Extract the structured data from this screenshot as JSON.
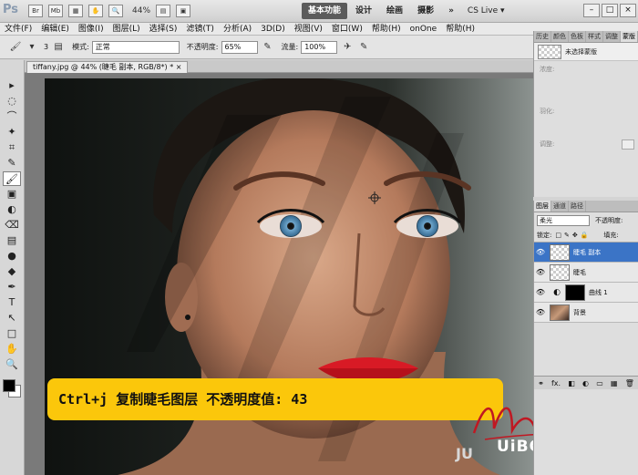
{
  "appbar": {
    "logo": "Ps",
    "icon_br": "Br",
    "icon_mb": "Mb",
    "zoom": "44%",
    "workspaces": [
      "基本功能",
      "设计",
      "绘画",
      "摄影"
    ],
    "more": "»",
    "cslive": "CS Live ▾",
    "window_buttons": [
      "–",
      "□",
      "×"
    ]
  },
  "menu": [
    "文件(F)",
    "编辑(E)",
    "图像(I)",
    "图层(L)",
    "选择(S)",
    "滤镜(T)",
    "分析(A)",
    "3D(D)",
    "视图(V)",
    "窗口(W)",
    "帮助(H)",
    "onOne",
    "帮助(H)"
  ],
  "options": {
    "brush_size": "3",
    "mode_label": "模式:",
    "mode_value": "正常",
    "opacity_label": "不透明度:",
    "opacity_value": "65%",
    "flow_label": "流量:",
    "flow_value": "100%"
  },
  "document": {
    "tab_title": "tiffany.jpg @ 44% (睫毛 副本, RGB/8*) * ×"
  },
  "tools": [
    "▸",
    "◌",
    "⌒",
    "✦",
    "⌗",
    "✎",
    "🖌",
    "▣",
    "◐",
    "⌫",
    "▤",
    "●",
    "◆",
    "✒",
    "T",
    "↖",
    "□",
    "✋",
    "🔍"
  ],
  "canvas": {
    "caption": "Ctrl+j 复制睫毛图层 不透明度值: 43",
    "signature": "Muxiaoqi",
    "watermark": "UiBQ.CoM",
    "watermark_sub": "JU"
  },
  "history_panel": {
    "tabs": [
      "历史",
      "颜色",
      "色板",
      "样式",
      "调整",
      "蒙版"
    ],
    "row_label": "未选择蒙版",
    "adjust_rows": [
      "浓度:",
      "羽化:",
      "调整:"
    ]
  },
  "layers_panel": {
    "tabs": [
      "图层",
      "通道",
      "路径"
    ],
    "blend_mode": "柔光",
    "opacity_label": "不透明度:",
    "lock_label": "锁定:",
    "fill_label": "填充:",
    "layers": [
      {
        "name": "睫毛 副本",
        "selected": true
      },
      {
        "name": "睫毛",
        "selected": false
      },
      {
        "name": "曲线 1",
        "selected": false
      },
      {
        "name": "背景",
        "selected": false
      }
    ],
    "footer_icons": [
      "⚭",
      "fx.",
      "◧",
      "◐",
      "▭",
      "▦",
      "🗑"
    ]
  },
  "colors": {
    "banner": "#fbc70b",
    "selected_layer": "#3b74c6",
    "lip": "#d81a25",
    "iris": "#5a8fb8"
  }
}
